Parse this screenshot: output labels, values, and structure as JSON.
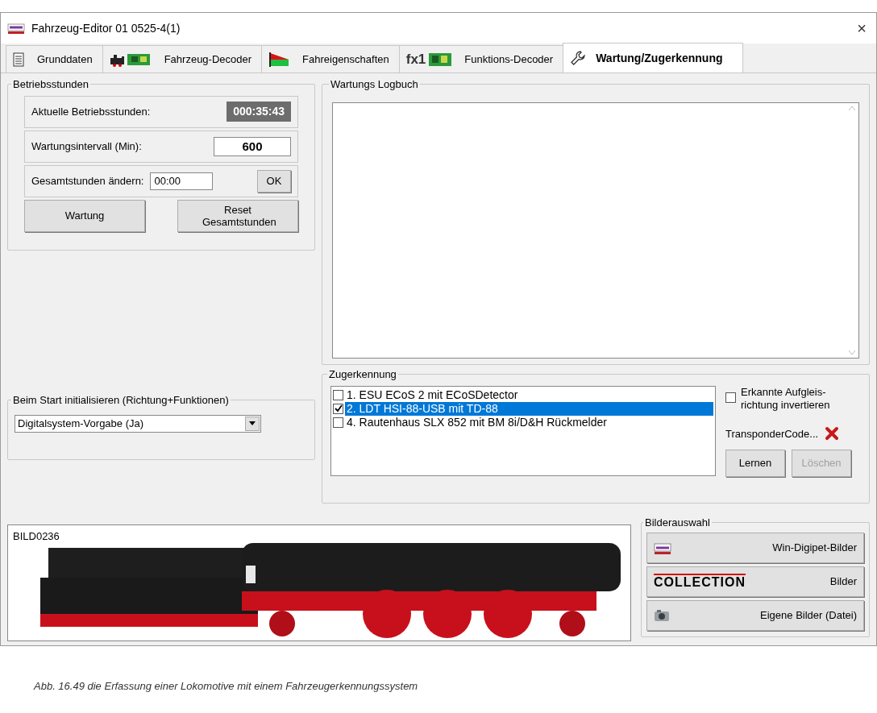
{
  "window": {
    "title": "Fahrzeug-Editor 01 0525-4(1)",
    "close": "×"
  },
  "tabs": [
    {
      "label": "Grunddaten",
      "kind": "document",
      "selected": false
    },
    {
      "label": "Fahrzeug-Decoder",
      "kind": "locomotive",
      "selected": false
    },
    {
      "label": "Fahreigenschaften",
      "kind": "wedge",
      "selected": false
    },
    {
      "label": "Funktions-Decoder",
      "kind": "function",
      "badge": "fx1",
      "selected": false
    },
    {
      "label": "Wartung/Zugerkennung",
      "kind": "wrench",
      "selected": true
    }
  ],
  "betriebsstunden": {
    "title": "Betriebsstunden",
    "current_label": "Aktuelle Betriebsstunden:",
    "current_value": "000:35:43",
    "interval_label": "Wartungsintervall  (Min):",
    "interval_value": "600",
    "change_label": "Gesamtstunden ändern:",
    "change_value": "00:00",
    "ok": "OK",
    "wartung": "Wartung",
    "reset": "Reset Gesamtstunden"
  },
  "start_init": {
    "title": "Beim Start initialisieren (Richtung+Funktionen)",
    "value": "Digitalsystem-Vorgabe (Ja)"
  },
  "logbuch": {
    "title": "Wartungs Logbuch"
  },
  "zugerkennung": {
    "title": "Zugerkennung",
    "systems": [
      {
        "label": "1. ESU ECoS 2 mit ECoSDetector",
        "checked": false,
        "selected": false
      },
      {
        "label": "2. LDT HSI-88-USB mit TD-88",
        "checked": true,
        "selected": true
      },
      {
        "label": "4. Rautenhaus SLX 852 mit BM 8i/D&H Rückmelder",
        "checked": false,
        "selected": false
      }
    ],
    "invert": {
      "label": "Erkannte Aufgleis-richtung invertieren",
      "checked": false
    },
    "transponder": "TransponderCode...",
    "learn": {
      "label": "Lernen",
      "disabled": false
    },
    "delete": {
      "label": "Löschen",
      "disabled": true
    }
  },
  "image": {
    "name": "BILD0236"
  },
  "bilderauswahl": {
    "title": "Bilderauswahl",
    "buttons": [
      {
        "kind": "wdp",
        "label": "Win-Digipet-Bilder"
      },
      {
        "kind": "collection",
        "logo": "COLLECTION",
        "label": "Bilder"
      },
      {
        "kind": "camera",
        "label": "Eigene Bilder (Datei)"
      }
    ]
  },
  "caption": "Abb. 16.49  die Erfassung einer Lokomotive mit einem Fahrzeugerkennungssystem"
}
